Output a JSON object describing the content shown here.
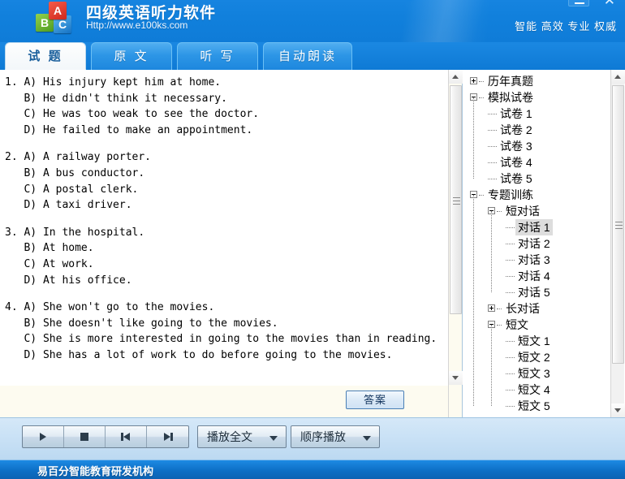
{
  "window": {
    "minimize_label": "—",
    "maximize_label": "❐",
    "close_label": "✕"
  },
  "header": {
    "title": "四级英语听力软件",
    "url": "Http://www.e100ks.com",
    "slogan": "智能 高效 专业 权威",
    "logo": {
      "a": "A",
      "b": "B",
      "c": "C"
    },
    "accent_color": "#1180dc"
  },
  "tabs": [
    {
      "label": "试  题",
      "active": true
    },
    {
      "label": "原  文",
      "active": false
    },
    {
      "label": "听  写",
      "active": false
    },
    {
      "label": "自动朗读",
      "active": false
    }
  ],
  "questions": [
    {
      "number": "1.",
      "options": [
        "A) His injury kept him at home.",
        "B) He didn't think it necessary.",
        "C) He was too weak to see the doctor.",
        "D) He failed to make an appointment."
      ]
    },
    {
      "number": "2.",
      "options": [
        "A) A railway porter.",
        "B) A bus conductor.",
        "C) A postal clerk.",
        "D) A taxi driver."
      ]
    },
    {
      "number": "3.",
      "options": [
        "A) In the hospital.",
        "B) At home.",
        "C) At work.",
        "D) At his office."
      ]
    },
    {
      "number": "4.",
      "options": [
        "A) She won't go to the movies.",
        "B) She doesn't like going to the movies.",
        "C) She is more interested in going to the movies than in reading.",
        "D) She has a lot of work to do before going to the movies."
      ]
    }
  ],
  "answer_button": {
    "label": "答案"
  },
  "tree": {
    "nodes": [
      {
        "label": "历年真题",
        "depth": 0,
        "box": "plus",
        "selected": false
      },
      {
        "label": "模拟试卷",
        "depth": 0,
        "box": "minus",
        "selected": false
      },
      {
        "label": "试卷 1",
        "depth": 1,
        "box": "none",
        "selected": false
      },
      {
        "label": "试卷 2",
        "depth": 1,
        "box": "none",
        "selected": false
      },
      {
        "label": "试卷 3",
        "depth": 1,
        "box": "none",
        "selected": false
      },
      {
        "label": "试卷 4",
        "depth": 1,
        "box": "none",
        "selected": false
      },
      {
        "label": "试卷 5",
        "depth": 1,
        "box": "none",
        "selected": false
      },
      {
        "label": "专题训练",
        "depth": 0,
        "box": "minus",
        "selected": false
      },
      {
        "label": "短对话",
        "depth": 1,
        "box": "minus",
        "selected": false
      },
      {
        "label": "对话 1",
        "depth": 2,
        "box": "none",
        "selected": true
      },
      {
        "label": "对话 2",
        "depth": 2,
        "box": "none",
        "selected": false
      },
      {
        "label": "对话 3",
        "depth": 2,
        "box": "none",
        "selected": false
      },
      {
        "label": "对话 4",
        "depth": 2,
        "box": "none",
        "selected": false
      },
      {
        "label": "对话 5",
        "depth": 2,
        "box": "none",
        "selected": false
      },
      {
        "label": "长对话",
        "depth": 1,
        "box": "plus",
        "selected": false
      },
      {
        "label": "短文",
        "depth": 1,
        "box": "minus",
        "selected": false
      },
      {
        "label": "短文 1",
        "depth": 2,
        "box": "none",
        "selected": false
      },
      {
        "label": "短文 2",
        "depth": 2,
        "box": "none",
        "selected": false
      },
      {
        "label": "短文 3",
        "depth": 2,
        "box": "none",
        "selected": false
      },
      {
        "label": "短文 4",
        "depth": 2,
        "box": "none",
        "selected": false
      },
      {
        "label": "短文 5",
        "depth": 2,
        "box": "none",
        "selected": false
      }
    ]
  },
  "toolbar": {
    "transport": [
      {
        "name": "play-button",
        "icon": "play-icon"
      },
      {
        "name": "stop-button",
        "icon": "stop-icon"
      },
      {
        "name": "prev-button",
        "icon": "previous-icon"
      },
      {
        "name": "next-button",
        "icon": "next-icon"
      }
    ],
    "play_scope_label": "播放全文",
    "play_order_label": "顺序播放"
  },
  "statusbar": {
    "text": "易百分智能教育研发机构"
  }
}
